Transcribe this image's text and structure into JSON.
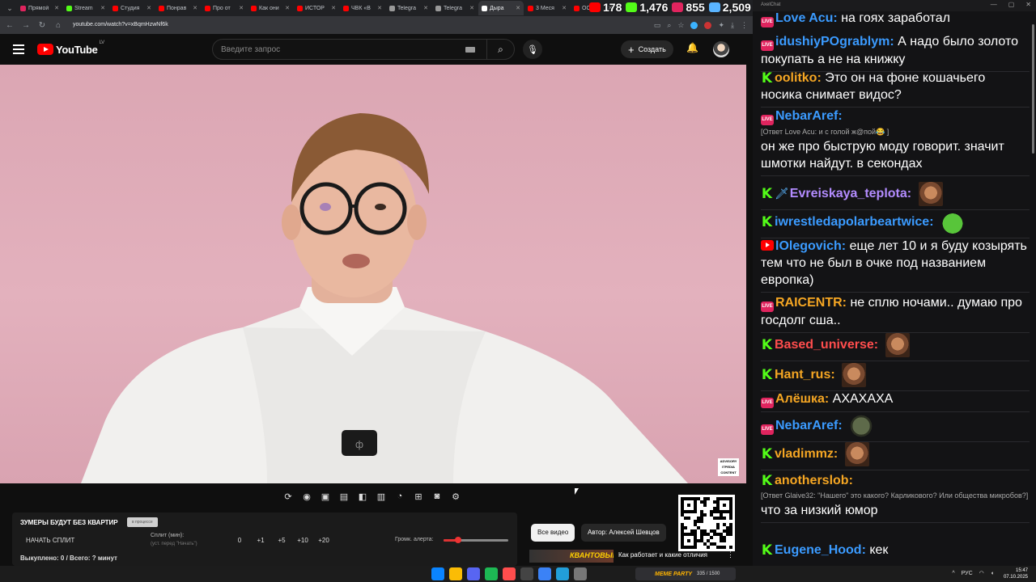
{
  "browser": {
    "tabs": [
      {
        "title": "Прямой",
        "color": "#e0245e"
      },
      {
        "title": "Stream",
        "color": "#53fc18"
      },
      {
        "title": "Студия",
        "color": "#ff0000"
      },
      {
        "title": "Понрав",
        "color": "#ff0000"
      },
      {
        "title": "Про от",
        "color": "#ff0000"
      },
      {
        "title": "Как они",
        "color": "#ff0000"
      },
      {
        "title": "ИСТОР",
        "color": "#ff0000"
      },
      {
        "title": "ЧВК «В",
        "color": "#ff0000"
      },
      {
        "title": "Telegra",
        "color": "#999999"
      },
      {
        "title": "Telegra",
        "color": "#999999"
      },
      {
        "title": "Дыра",
        "color": "#ffffff"
      },
      {
        "title": "3 Меся",
        "color": "#ff0000"
      },
      {
        "title": "ОС",
        "color": "#ff0000"
      }
    ],
    "url": "youtube.com/watch?v=xBqmHzwNf6k"
  },
  "counters": [
    {
      "platform": "youtube",
      "color": "#ff0000",
      "value": "178"
    },
    {
      "platform": "kick",
      "color": "#53fc18",
      "value": "1,476"
    },
    {
      "platform": "vk",
      "color": "#e0245e",
      "value": "855"
    },
    {
      "platform": "twitch",
      "color": "#5ab4ff",
      "value": "2,509"
    }
  ],
  "youtube": {
    "logo_text": "YouTube",
    "logo_region": "LV",
    "search_placeholder": "Введите запрос",
    "create_label": "Создать"
  },
  "panel": {
    "title": "ЗУМЕРЫ БУДУТ БЕЗ КВАРТИР",
    "chip": "в процессе",
    "start_split": "НАЧАТЬ СПЛИТ",
    "split_label": "Сплит (мин):",
    "split_hint": "(уст. перед \"Начать\")",
    "split_values": [
      "0",
      "+1",
      "+5",
      "+10",
      "+20"
    ],
    "volume_label": "Громк. алерта:",
    "volume_level": 0.22,
    "footer": "Выкуплено: 0 / Всего: ? минут"
  },
  "meta": {
    "all_videos": "Все видео",
    "author": "Автор: Алексей Шевцов",
    "rec_thumb_text": "КВАНТОВЫЙ",
    "rec_title": "Как работает и какие отличия"
  },
  "chat": {
    "title": "AxelChat",
    "messages": [
      {
        "platform": "vk",
        "nick": "Love Acu:",
        "color": "#3b9bff",
        "text": "на гоях заработал"
      },
      {
        "platform": "vk",
        "nick": "idushiyPOgrablym:",
        "color": "#3b9bff",
        "text": "А надо было золото покупать а не на книжку"
      },
      {
        "platform": "kick",
        "nick": "oolitko:",
        "color": "#f5a623",
        "text": "Это он на фоне кошачьего носика снимает видос?"
      },
      {
        "platform": "vk",
        "nick": "NebarAref:",
        "color": "#3b9bff",
        "reply": "[Ответ Love Acu: и с голой ж@пой😂 ]",
        "text": "он же про быструю моду говорит. значит шмотки найдут. в секондах"
      },
      {
        "platform": "kick",
        "nick": "Evreiskaya_teplota:",
        "color": "#b38cff",
        "text": "",
        "emote": "face"
      },
      {
        "platform": "kick",
        "nick": "iwrestledapolarbeartwice:",
        "color": "#3b9bff",
        "text": "",
        "emote": "pepe"
      },
      {
        "platform": "youtube",
        "nick": "lOlegovich:",
        "color": "#3b9bff",
        "text": "еще лет 10 и я буду козырять тем что не был в очке под названием европка)"
      },
      {
        "platform": "vk",
        "nick": "RAICENTR:",
        "color": "#f5a623",
        "text": "не сплю ночами.. думаю про госдолг сша.."
      },
      {
        "platform": "kick",
        "nick": "Based_universe:",
        "color": "#ff4d4d",
        "text": "",
        "emote": "face"
      },
      {
        "platform": "kick",
        "nick": "Hant_rus:",
        "color": "#f5a623",
        "text": "",
        "emote": "face"
      },
      {
        "platform": "vk",
        "nick": "Алёшка:",
        "color": "#f5a623",
        "text": "АХАХАХА"
      },
      {
        "platform": "vk",
        "nick": "NebarAref:",
        "color": "#3b9bff",
        "text": "",
        "emote": "alien"
      },
      {
        "platform": "kick",
        "nick": "vladimmz:",
        "color": "#f5a623",
        "text": "",
        "emote": "face"
      },
      {
        "platform": "kick",
        "nick": "anotherslob:",
        "color": "#f5a623",
        "reply": "[Ответ Glaive32: \"Нашего\" это какого? Карликового? Или общества микробов?]",
        "text": "что за низкий юмор"
      },
      {
        "platform": "kick",
        "nick": "Eugene_Hood:",
        "color": "#3b9bff",
        "text": "кек"
      }
    ]
  },
  "taskbar": {
    "stream_name": "MEME PARTY",
    "stream_count": "335 / 1500",
    "lang": "РУС",
    "time": "15:47",
    "date": "07.10.2025",
    "icons": [
      "#0a84ff",
      "#fbbc05",
      "#5865f2",
      "#1db954",
      "#ff4d4d",
      "#444444",
      "#3b82f6",
      "#229ed9",
      "#777777"
    ]
  }
}
